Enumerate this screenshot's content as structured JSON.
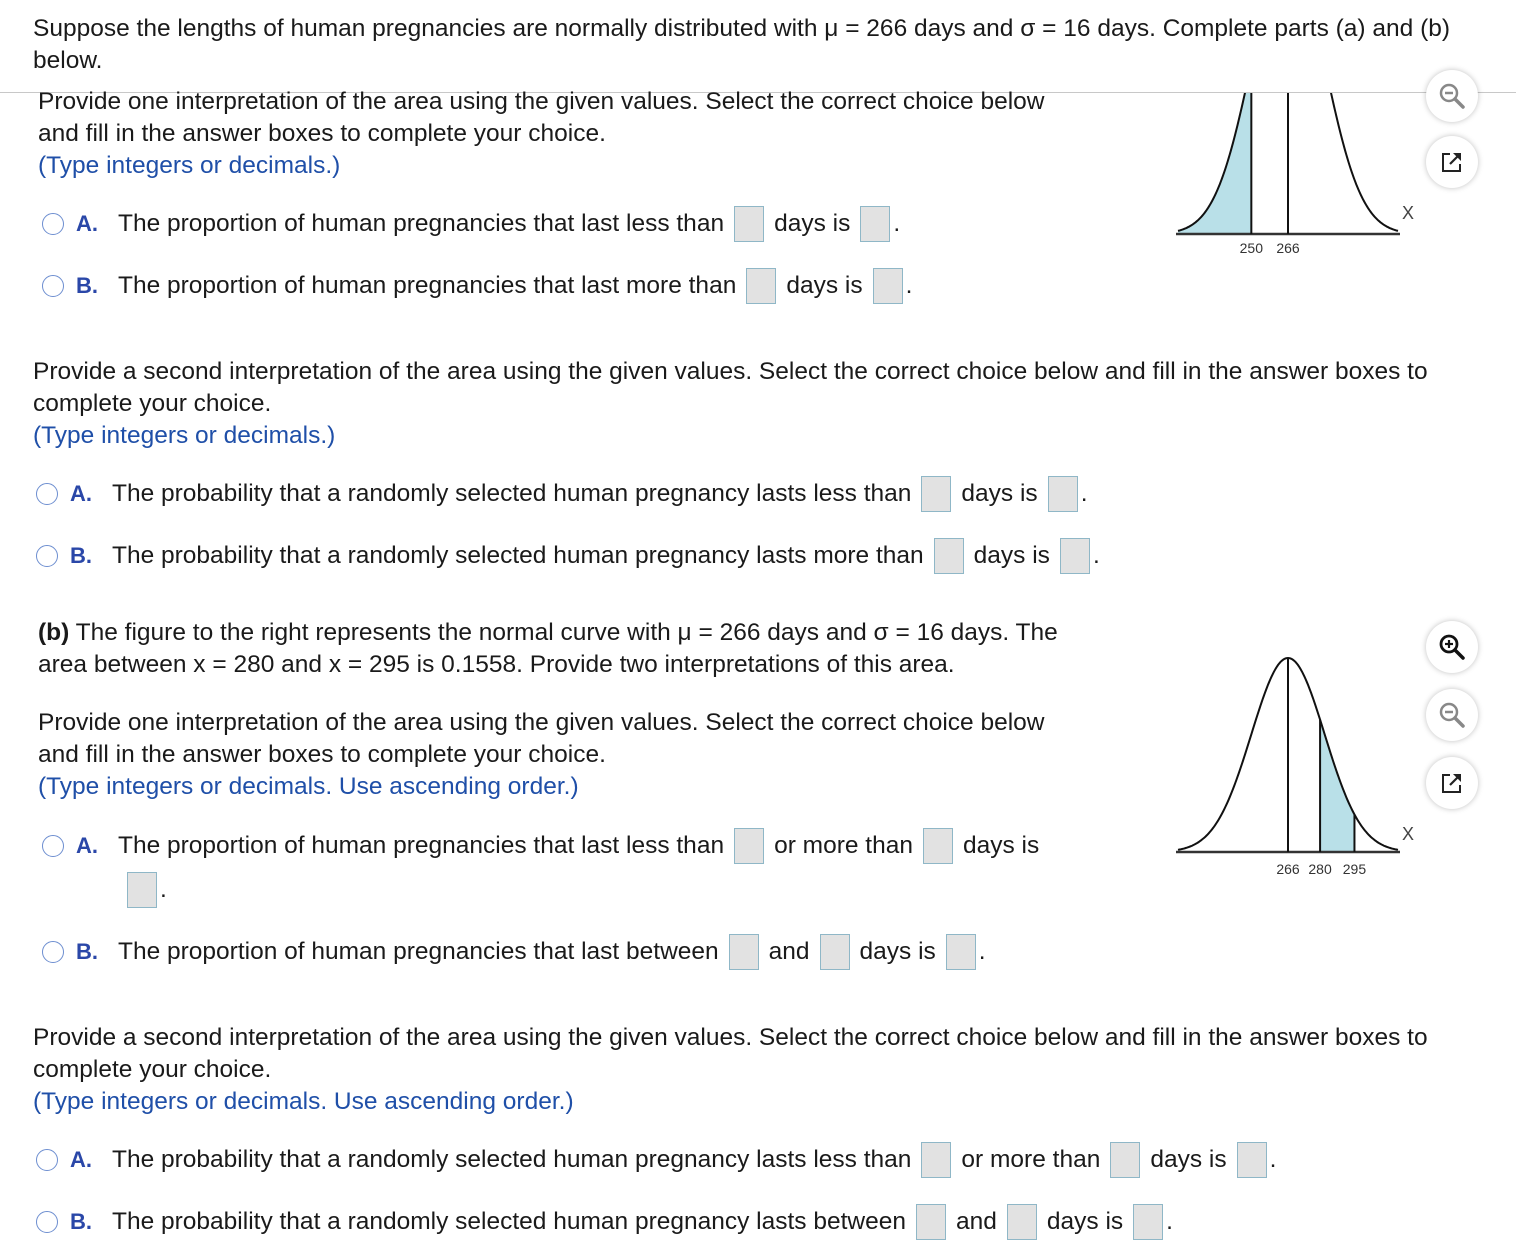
{
  "intro": "Suppose the lengths of human pregnancies are normally distributed with μ = 266 days and σ = 16 days. Complete parts (a) and (b) below.",
  "part_a": {
    "first": {
      "prompt_line1": "Provide one interpretation of the area using the given values. Select the correct choice below",
      "prompt_line2": "and fill in the answer boxes to complete your choice.",
      "hint": "(Type integers or decimals.)",
      "options": [
        {
          "letter": "A.",
          "text1": "The proportion of human pregnancies that last less than",
          "text2": "days is",
          "end": "."
        },
        {
          "letter": "B.",
          "text1": "The proportion of human pregnancies that last more than",
          "text2": "days is",
          "end": "."
        }
      ]
    },
    "second": {
      "prompt": "Provide a second interpretation of the area using the given values. Select the correct choice below and fill in the answer boxes to complete your choice.",
      "hint": "(Type integers or decimals.)",
      "options": [
        {
          "letter": "A.",
          "text1": "The probability that a randomly selected human pregnancy lasts less than",
          "text2": "days is",
          "end": "."
        },
        {
          "letter": "B.",
          "text1": "The probability that a randomly selected human pregnancy lasts more than",
          "text2": "days is",
          "end": "."
        }
      ]
    },
    "figure": {
      "x_axis_label": "X",
      "tick_labels": [
        "250",
        "266"
      ],
      "shaded": "left tail below 250"
    }
  },
  "part_b": {
    "label": "(b)",
    "statement_line1": " The figure to the right represents the normal curve with μ = 266 days and σ = 16 days. The",
    "statement_line2": "area between x = 280 and x = 295 is 0.1558. Provide two interpretations of this area.",
    "first": {
      "prompt_line1": "Provide one interpretation of the area using the given values. Select the correct choice below",
      "prompt_line2": "and fill in the answer boxes to complete your choice.",
      "hint": "(Type integers or decimals. Use ascending order.)",
      "options": [
        {
          "letter": "A.",
          "text1": "The proportion of human pregnancies that last less than",
          "text2": "or more than",
          "text3": "days is",
          "end": "."
        },
        {
          "letter": "B.",
          "text1": "The proportion of human pregnancies that last between",
          "text2": "and",
          "text3": "days is",
          "end": "."
        }
      ]
    },
    "second": {
      "prompt": "Provide a second interpretation of the area using the given values. Select the correct choice below and fill in the answer boxes to complete your choice.",
      "hint": "(Type integers or decimals. Use ascending order.)",
      "options": [
        {
          "letter": "A.",
          "text1": "The probability that a randomly selected human pregnancy lasts less than",
          "text2": "or more than",
          "text3": "days is",
          "end": "."
        },
        {
          "letter": "B.",
          "text1": "The probability that a randomly selected human pregnancy lasts between",
          "text2": "and",
          "text3": "days is",
          "end": "."
        }
      ]
    },
    "figure": {
      "x_axis_label": "X",
      "tick_labels": [
        "266",
        "280",
        "295"
      ],
      "shaded": "between 280 and 295"
    }
  },
  "figure_params": {
    "mu": 266,
    "sigma": 16,
    "x_min": 218,
    "x_max": 314
  },
  "tools": {
    "zoom_in": "zoom-in",
    "zoom_out": "zoom-out",
    "popout": "open-in-new-window"
  },
  "colors": {
    "shade": "#b9e0e8",
    "accent_letter": "#2a47a8",
    "hint_blue": "#1f4fa8"
  }
}
